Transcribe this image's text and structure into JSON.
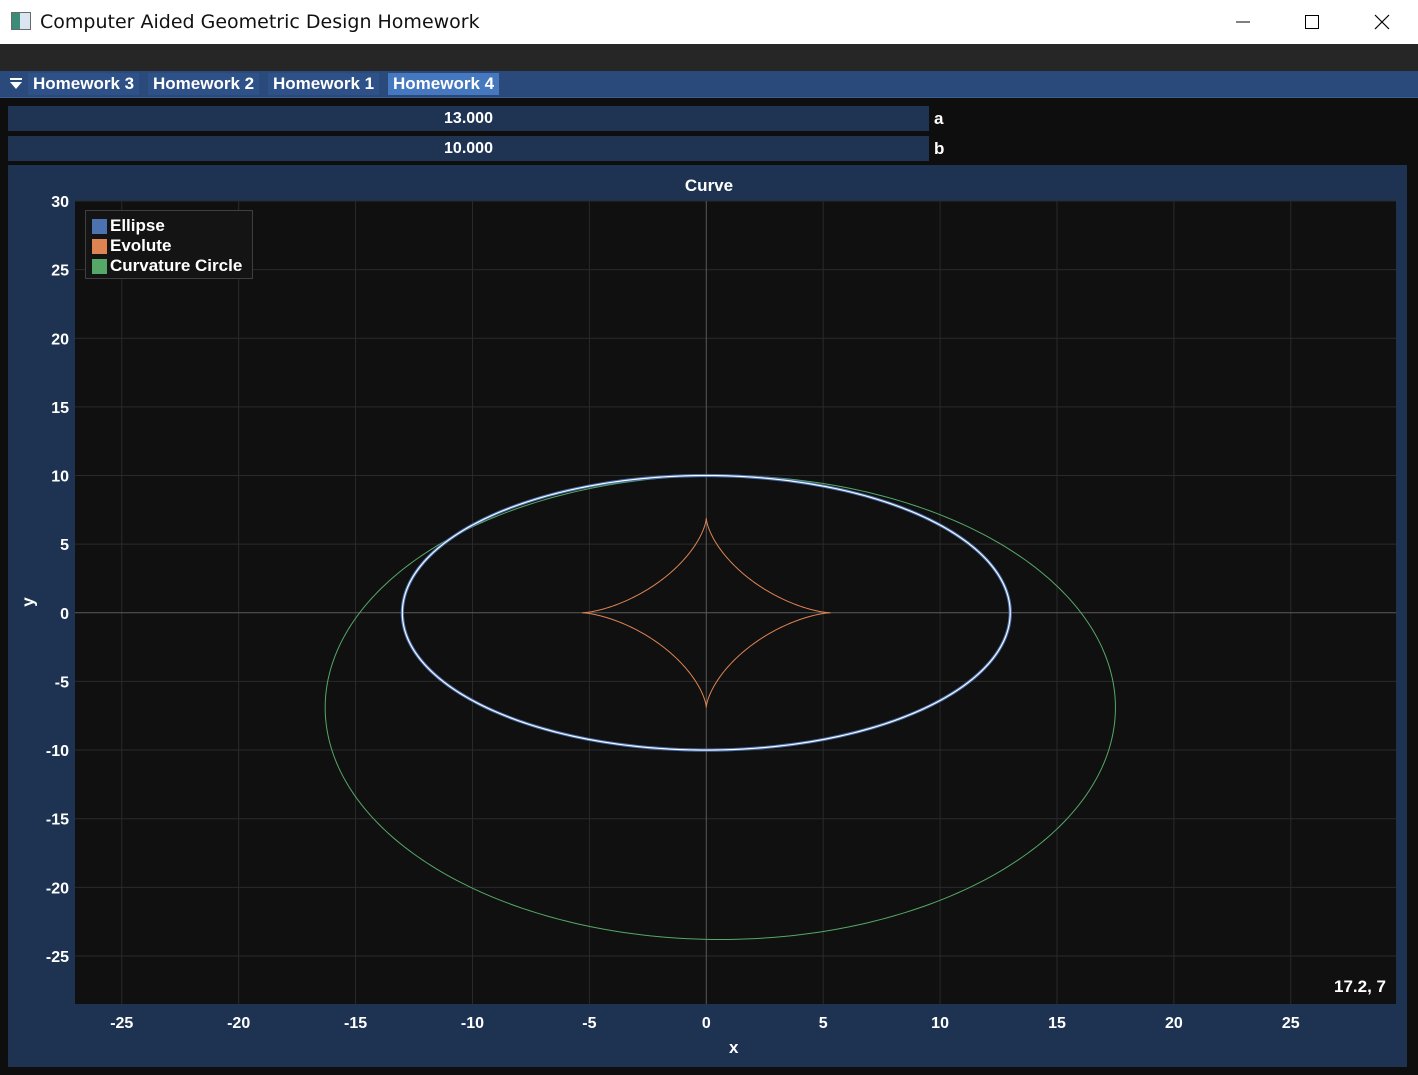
{
  "window": {
    "title": "Computer Aided Geometric Design Homework",
    "controls": [
      "minimize-icon",
      "maximize-icon",
      "close-icon"
    ]
  },
  "tabs": [
    {
      "label": "Homework 3",
      "active": false
    },
    {
      "label": "Homework 2",
      "active": false
    },
    {
      "label": "Homework 1",
      "active": false
    },
    {
      "label": "Homework 4",
      "active": true
    }
  ],
  "sliders": {
    "a": {
      "value": "13.000",
      "label": "a"
    },
    "b": {
      "value": "10.000",
      "label": "b"
    }
  },
  "colors": {
    "ellipse": "#4c72b0",
    "evolute": "#dd8452",
    "curvature_circle": "#55a868",
    "tab_active": "#4678bf",
    "frame": "#1e3352"
  },
  "coord_readout": "17.2, 7",
  "chart_data": {
    "type": "line",
    "title": "Curve",
    "xlabel": "x",
    "ylabel": "y",
    "xlim": [
      -27.0,
      29.5
    ],
    "ylim": [
      -28.5,
      30
    ],
    "xticks": [
      -25,
      -20,
      -15,
      -10,
      -5,
      0,
      5,
      10,
      15,
      20,
      25
    ],
    "yticks": [
      30,
      25,
      20,
      15,
      10,
      5,
      0,
      -5,
      -10,
      -15,
      -20,
      -25
    ],
    "grid": true,
    "legend_position": "top-left",
    "series": [
      {
        "name": "Ellipse",
        "kind": "ellipse",
        "a": 13,
        "b": 10
      },
      {
        "name": "Evolute",
        "kind": "astroid",
        "ax": 5.31,
        "ay": 6.9
      },
      {
        "name": "Curvature Circle",
        "kind": "ellipse_offset",
        "cx": 0.6,
        "cy": -6.9,
        "rx": 16.9,
        "ry": 16.9
      }
    ]
  }
}
